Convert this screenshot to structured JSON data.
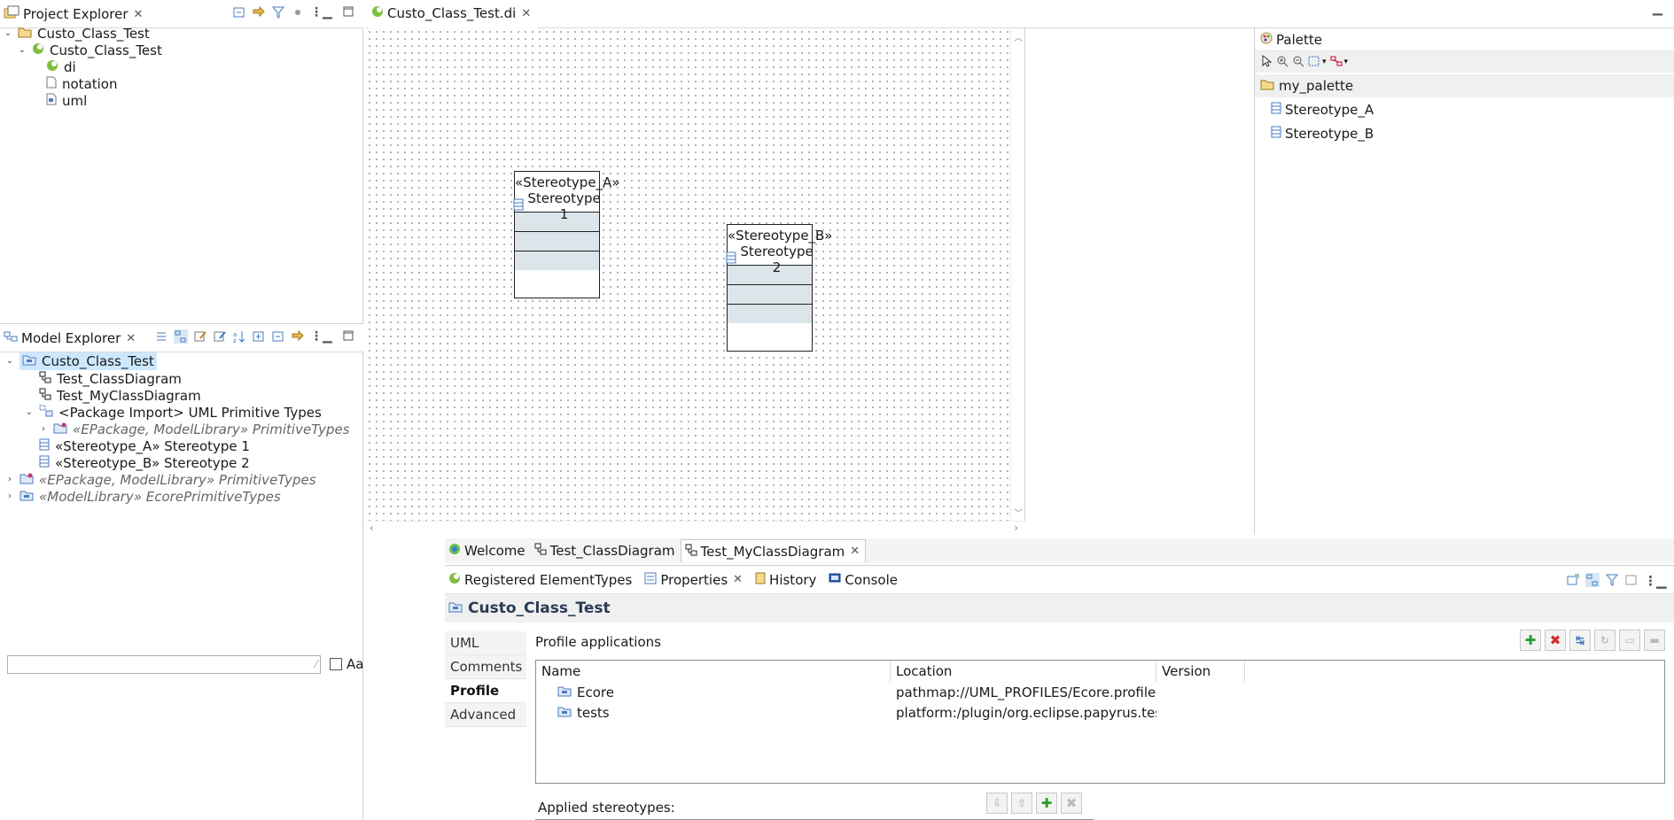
{
  "project_explorer": {
    "title": "Project Explorer",
    "items": [
      {
        "label": "Custo_Class_Test",
        "icon": "project-folder-icon"
      },
      {
        "label": "Custo_Class_Test",
        "icon": "papyrus-model-icon"
      },
      {
        "label": "di",
        "icon": "papyrus-di-icon"
      },
      {
        "label": "notation",
        "icon": "file-icon"
      },
      {
        "label": "uml",
        "icon": "uml-file-icon"
      }
    ]
  },
  "model_explorer": {
    "title": "Model Explorer",
    "items": [
      {
        "label": "Custo_Class_Test"
      },
      {
        "label": "Test_ClassDiagram"
      },
      {
        "label": "Test_MyClassDiagram"
      },
      {
        "label": "<Package Import> UML Primitive Types"
      },
      {
        "label": "«EPackage, ModelLibrary» PrimitiveTypes"
      },
      {
        "label": "«Stereotype_A» Stereotype 1"
      },
      {
        "label": "«Stereotype_B» Stereotype 2"
      },
      {
        "label": "«EPackage, ModelLibrary» PrimitiveTypes"
      },
      {
        "label": "«ModelLibrary» EcorePrimitiveTypes"
      }
    ],
    "filter_placeholder": "",
    "case_label": "Aa"
  },
  "editor": {
    "tab_label": "Custo_Class_Test.di",
    "classes": [
      {
        "stereotype": "«Stereotype_A»",
        "name": "Stereotype 1"
      },
      {
        "stereotype": "«Stereotype_B»",
        "name": "Stereotype 2"
      }
    ],
    "bottom_tabs": [
      "Welcome",
      "Test_ClassDiagram",
      "Test_MyClassDiagram"
    ]
  },
  "palette": {
    "title": "Palette",
    "drawer": "my_palette",
    "tools": [
      "Stereotype_A",
      "Stereotype_B"
    ]
  },
  "bottom_views": {
    "tabs": [
      "Registered ElementTypes",
      "Properties",
      "History",
      "Console"
    ]
  },
  "properties": {
    "element_title": "Custo_Class_Test",
    "side_tabs": [
      "UML",
      "Comments",
      "Profile",
      "Advanced"
    ],
    "active_side_tab": "Profile",
    "section_title": "Profile applications",
    "columns": [
      "Name",
      "Location",
      "Version"
    ],
    "rows": [
      {
        "name": "Ecore",
        "location": "pathmap://UML_PROFILES/Ecore.profile.uml",
        "version": ""
      },
      {
        "name": "tests",
        "location": "platform:/plugin/org.eclipse.papyrus.tests/pr",
        "version": ""
      }
    ],
    "applied_stereotypes_label": "Applied stereotypes:"
  },
  "colors": {
    "selection": "#cce8ff",
    "compartment": "#dbe5ea",
    "accent_green": "#2e9b2e",
    "accent_red": "#d22a2a"
  }
}
